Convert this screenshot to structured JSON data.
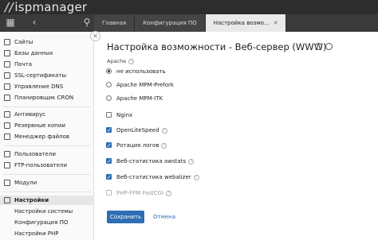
{
  "app": {
    "logo_mark": "//",
    "logo_text": "ispmanager"
  },
  "tabs": [
    {
      "label": "Главная"
    },
    {
      "label": "Конфигурация ПО"
    },
    {
      "label": "Настройка возмо..."
    }
  ],
  "sidebar": {
    "items": [
      {
        "label": "Сайты"
      },
      {
        "label": "Базы данных"
      },
      {
        "label": "Почта"
      },
      {
        "label": "SSL-сертификаты"
      },
      {
        "label": "Управление DNS"
      },
      {
        "label": "Планировщик CRON"
      },
      {
        "label": "Антивирус"
      },
      {
        "label": "Резервные копии"
      },
      {
        "label": "Менеджер файлов"
      },
      {
        "label": "Пользователи"
      },
      {
        "label": "FTP-пользователи"
      },
      {
        "label": "Модули"
      },
      {
        "label": "Настройки"
      },
      {
        "label": "Настройки системы"
      },
      {
        "label": "Конфигурация ПО"
      },
      {
        "label": "Настройки PHP"
      }
    ]
  },
  "main": {
    "title": "Настройка возможности - Веб-сервер (WWW)",
    "apache_label": "Apache",
    "apache_options": [
      {
        "label": "не использовать",
        "selected": true
      },
      {
        "label": "Apache MPM-Prefork",
        "selected": false
      },
      {
        "label": "Apache MPM-ITK",
        "selected": false
      }
    ],
    "checkboxes": [
      {
        "label": "Nginx",
        "checked": false
      },
      {
        "label": "OpenLiteSpeed",
        "checked": true
      },
      {
        "label": "Ротация логов",
        "checked": true
      },
      {
        "label": "Веб-статистика awstats",
        "checked": true
      },
      {
        "label": "Веб-статистика webalizer",
        "checked": true
      },
      {
        "label": "PHP-FPM FastCGI",
        "checked": false,
        "disabled": true
      }
    ],
    "save_label": "Сохранить",
    "cancel_label": "Отмена",
    "hint_glyph": "?"
  },
  "colors": {
    "accent": "#2f6db4",
    "topbar": "#2d2d2d"
  }
}
